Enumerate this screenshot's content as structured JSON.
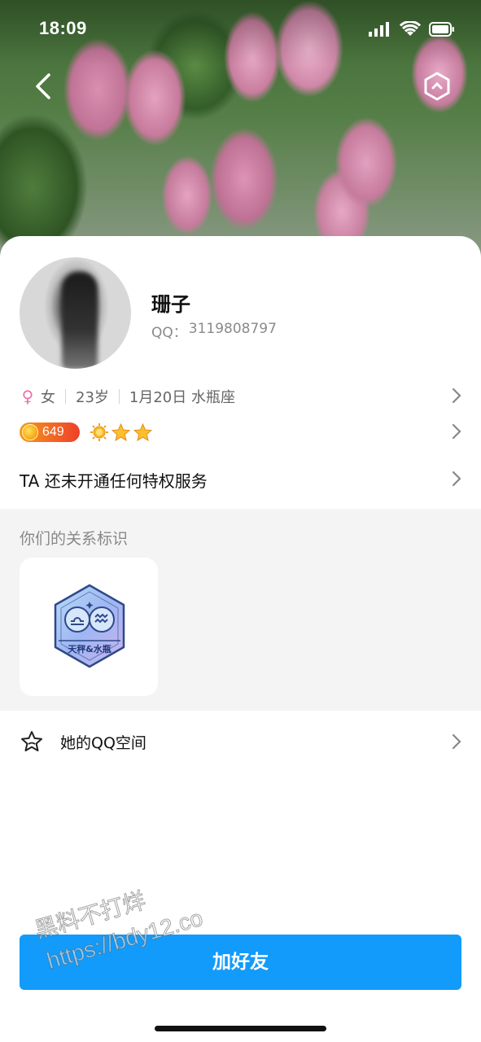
{
  "status_bar": {
    "time": "18:09"
  },
  "profile": {
    "name": "珊子",
    "qq_label": "QQ：",
    "qq_number": "3119808797",
    "gender": "女",
    "age": "23岁",
    "birthday": "1月20日 水瓶座",
    "coin_level": "649",
    "privilege_text": "TA 还未开通任何特权服务"
  },
  "relationship": {
    "title": "你们的关系标识",
    "badge_label": "天秤&水瓶"
  },
  "qzone": {
    "label": "她的QQ空间"
  },
  "add_friend_label": "加好友",
  "watermark": {
    "line1": "黑料不打烊",
    "line2": "https://bdy12.co"
  },
  "icons": [
    "back-icon",
    "hexagon-icon",
    "female-icon",
    "coin-icon",
    "crown-icon",
    "star-icon",
    "chevron-right-icon",
    "star-outline-icon"
  ],
  "colors": {
    "accent": "#129bfb",
    "female": "#f06fa8",
    "coin": "#f59a1d"
  }
}
